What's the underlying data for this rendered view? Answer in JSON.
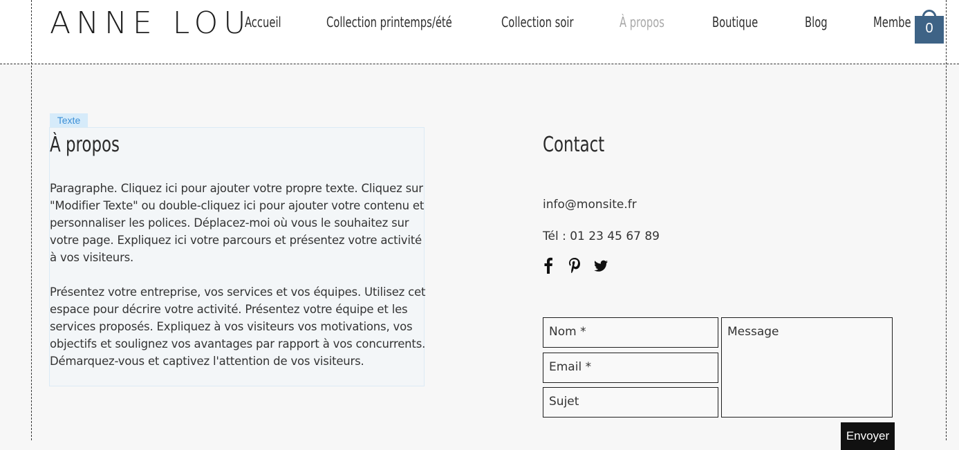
{
  "header": {
    "logo": "ANNE LOU",
    "nav": [
      {
        "label": "Accueil"
      },
      {
        "label": "Collection printemps/été"
      },
      {
        "label": "Collection soir"
      },
      {
        "label": "À propos"
      },
      {
        "label": "Boutique"
      },
      {
        "label": "Blog"
      },
      {
        "label": "Membe"
      }
    ],
    "cart_count": "0"
  },
  "editor": {
    "text_tag": "Texte"
  },
  "about": {
    "title": "À propos",
    "paragraph1": "Paragraphe. Cliquez ici pour ajouter votre propre texte. Cliquez sur \"Modifier Texte\" ou double-cliquez ici pour ajouter votre contenu et personnaliser les polices. Déplacez-moi où vous le souhaitez sur votre page. Expliquez ici votre parcours et présentez votre activité à vos visiteurs.",
    "paragraph2": "Présentez votre entreprise, vos services et vos équipes. Utilisez cet espace pour décrire votre activité. Présentez votre équipe et les services proposés. Expliquez à vos visiteurs vos motivations, vos objectifs et soulignez vos avantages par rapport à vos concurrents. Démarquez-vous et captivez l'attention de vos visiteurs."
  },
  "contact": {
    "title": "Contact",
    "email": "info@monsite.fr",
    "phone": "Tél : 01 23 45 67 89",
    "social_icons": [
      "facebook-icon",
      "pinterest-icon",
      "twitter-icon"
    ],
    "form": {
      "name_placeholder": "Nom *",
      "email_placeholder": "Email *",
      "subject_placeholder": "Sujet",
      "message_placeholder": "Message",
      "send_label": "Envoyer"
    }
  },
  "colors": {
    "background": "#f7f7f7",
    "cart": "#3e6386",
    "nav_active": "#a8a8a8",
    "tag": "#d6ebfa"
  }
}
